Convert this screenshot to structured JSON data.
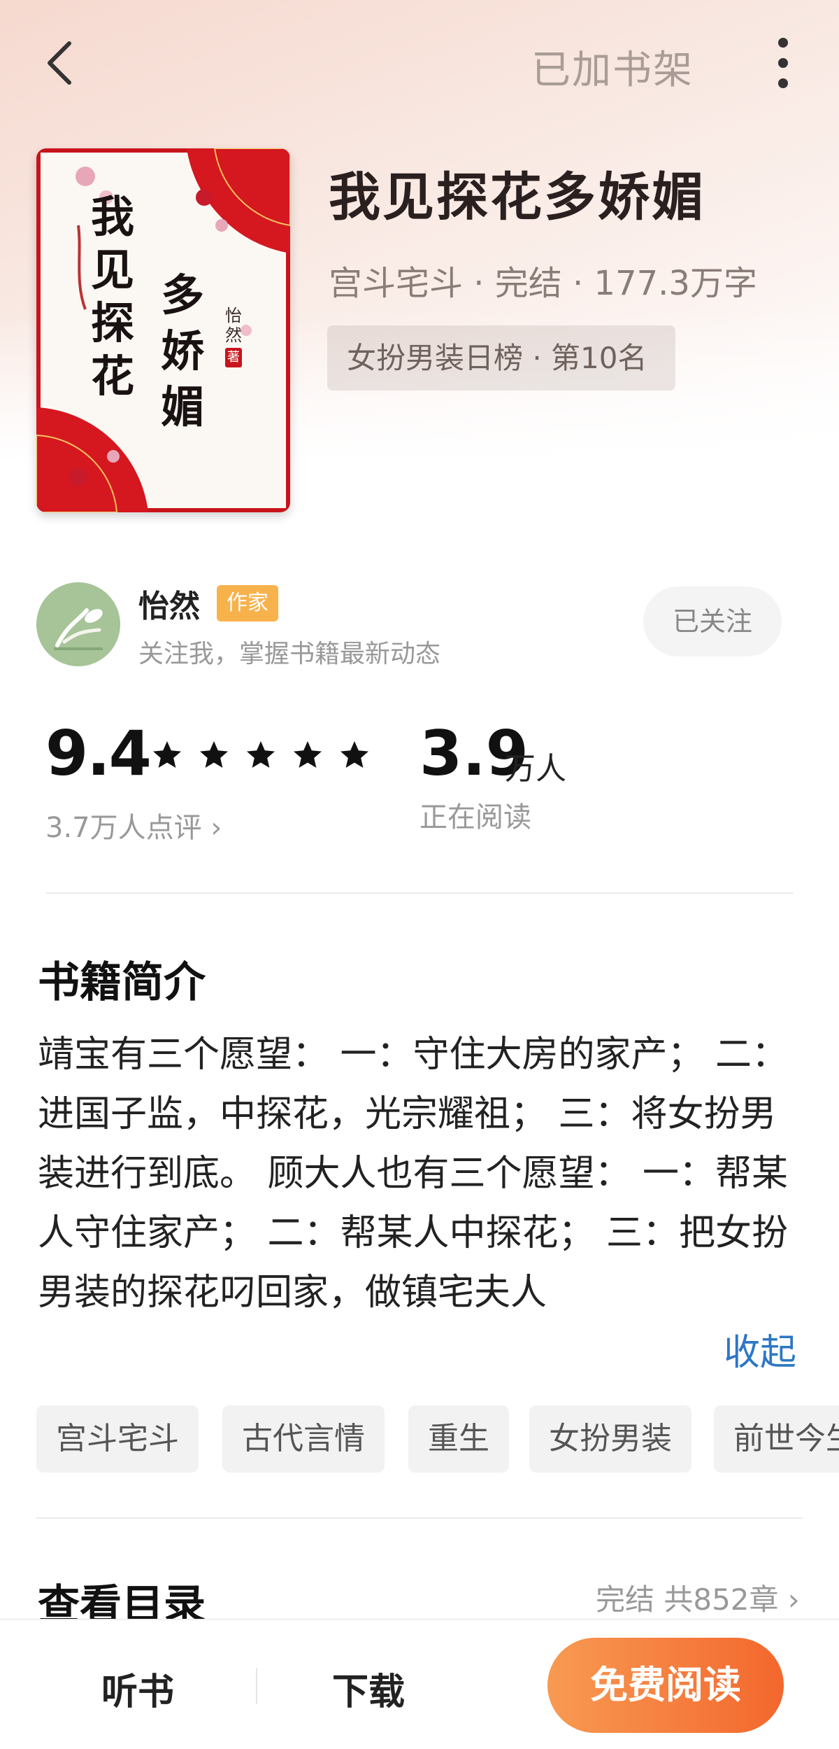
{
  "header": {
    "shelf_label": "已加书架"
  },
  "book": {
    "title": "我见探花多娇媚",
    "meta": "宫斗宅斗 · 完结 · 177.3万字",
    "rank": "女扮男装日榜 · 第10名",
    "cover": {
      "title_chars": [
        "我",
        "见",
        "探",
        "花",
        "多",
        "娇",
        "媚"
      ],
      "author_mark": "怡然",
      "author_suffix": "著",
      "colors": {
        "frame": "#c8141c",
        "fan": "#d5171f",
        "ink": "#1a1212"
      }
    }
  },
  "author": {
    "name": "怡然",
    "tag": "作家",
    "desc": "关注我，掌握书籍最新动态",
    "follow_label": "已关注"
  },
  "stats": {
    "score": "9.4",
    "stars": 5,
    "review_link": "3.7万人点评 ›",
    "readers_value": "3.9",
    "readers_unit": "万人",
    "readers_label": "正在阅读"
  },
  "intro": {
    "title": "书籍简介",
    "text": "靖宝有三个愿望： 一：守住大房的家产； 二：进国子监，中探花，光宗耀祖； 三：将女扮男装进行到底。 顾大人也有三个愿望： 一：帮某人守住家产； 二：帮某人中探花； 三：把女扮男装的探花叼回家，做镇宅夫人",
    "collapse_label": "收起"
  },
  "tags": [
    "宫斗宅斗",
    "古代言情",
    "重生",
    "女扮男装",
    "前世今生"
  ],
  "toc": {
    "title": "查看目录",
    "meta": "完结 共852章 ›"
  },
  "bottom": {
    "listen_label": "听书",
    "download_label": "下载",
    "read_label": "免费阅读"
  },
  "colors": {
    "accent": "#f3672d",
    "link": "#2d77c5",
    "author_tag": "#f8b24c"
  }
}
